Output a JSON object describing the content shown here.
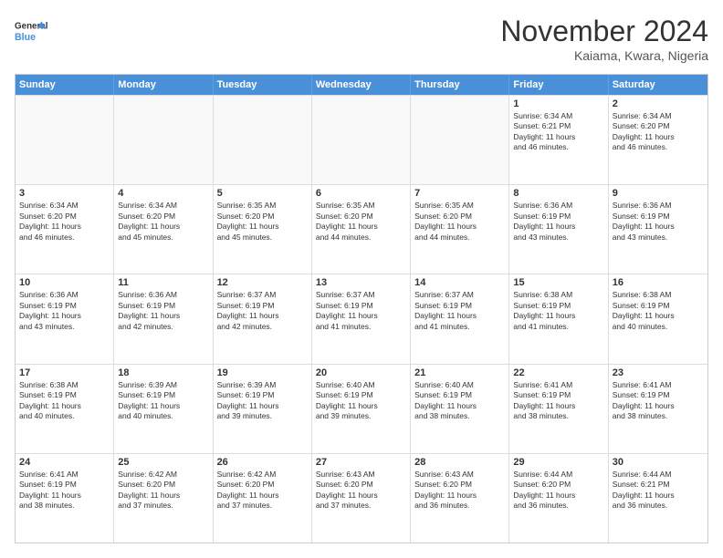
{
  "logo": {
    "line1": "General",
    "line2": "Blue"
  },
  "title": "November 2024",
  "location": "Kaiama, Kwara, Nigeria",
  "header_days": [
    "Sunday",
    "Monday",
    "Tuesday",
    "Wednesday",
    "Thursday",
    "Friday",
    "Saturday"
  ],
  "weeks": [
    [
      {
        "day": "",
        "info": ""
      },
      {
        "day": "",
        "info": ""
      },
      {
        "day": "",
        "info": ""
      },
      {
        "day": "",
        "info": ""
      },
      {
        "day": "",
        "info": ""
      },
      {
        "day": "1",
        "info": "Sunrise: 6:34 AM\nSunset: 6:21 PM\nDaylight: 11 hours\nand 46 minutes."
      },
      {
        "day": "2",
        "info": "Sunrise: 6:34 AM\nSunset: 6:20 PM\nDaylight: 11 hours\nand 46 minutes."
      }
    ],
    [
      {
        "day": "3",
        "info": "Sunrise: 6:34 AM\nSunset: 6:20 PM\nDaylight: 11 hours\nand 46 minutes."
      },
      {
        "day": "4",
        "info": "Sunrise: 6:34 AM\nSunset: 6:20 PM\nDaylight: 11 hours\nand 45 minutes."
      },
      {
        "day": "5",
        "info": "Sunrise: 6:35 AM\nSunset: 6:20 PM\nDaylight: 11 hours\nand 45 minutes."
      },
      {
        "day": "6",
        "info": "Sunrise: 6:35 AM\nSunset: 6:20 PM\nDaylight: 11 hours\nand 44 minutes."
      },
      {
        "day": "7",
        "info": "Sunrise: 6:35 AM\nSunset: 6:20 PM\nDaylight: 11 hours\nand 44 minutes."
      },
      {
        "day": "8",
        "info": "Sunrise: 6:36 AM\nSunset: 6:19 PM\nDaylight: 11 hours\nand 43 minutes."
      },
      {
        "day": "9",
        "info": "Sunrise: 6:36 AM\nSunset: 6:19 PM\nDaylight: 11 hours\nand 43 minutes."
      }
    ],
    [
      {
        "day": "10",
        "info": "Sunrise: 6:36 AM\nSunset: 6:19 PM\nDaylight: 11 hours\nand 43 minutes."
      },
      {
        "day": "11",
        "info": "Sunrise: 6:36 AM\nSunset: 6:19 PM\nDaylight: 11 hours\nand 42 minutes."
      },
      {
        "day": "12",
        "info": "Sunrise: 6:37 AM\nSunset: 6:19 PM\nDaylight: 11 hours\nand 42 minutes."
      },
      {
        "day": "13",
        "info": "Sunrise: 6:37 AM\nSunset: 6:19 PM\nDaylight: 11 hours\nand 41 minutes."
      },
      {
        "day": "14",
        "info": "Sunrise: 6:37 AM\nSunset: 6:19 PM\nDaylight: 11 hours\nand 41 minutes."
      },
      {
        "day": "15",
        "info": "Sunrise: 6:38 AM\nSunset: 6:19 PM\nDaylight: 11 hours\nand 41 minutes."
      },
      {
        "day": "16",
        "info": "Sunrise: 6:38 AM\nSunset: 6:19 PM\nDaylight: 11 hours\nand 40 minutes."
      }
    ],
    [
      {
        "day": "17",
        "info": "Sunrise: 6:38 AM\nSunset: 6:19 PM\nDaylight: 11 hours\nand 40 minutes."
      },
      {
        "day": "18",
        "info": "Sunrise: 6:39 AM\nSunset: 6:19 PM\nDaylight: 11 hours\nand 40 minutes."
      },
      {
        "day": "19",
        "info": "Sunrise: 6:39 AM\nSunset: 6:19 PM\nDaylight: 11 hours\nand 39 minutes."
      },
      {
        "day": "20",
        "info": "Sunrise: 6:40 AM\nSunset: 6:19 PM\nDaylight: 11 hours\nand 39 minutes."
      },
      {
        "day": "21",
        "info": "Sunrise: 6:40 AM\nSunset: 6:19 PM\nDaylight: 11 hours\nand 38 minutes."
      },
      {
        "day": "22",
        "info": "Sunrise: 6:41 AM\nSunset: 6:19 PM\nDaylight: 11 hours\nand 38 minutes."
      },
      {
        "day": "23",
        "info": "Sunrise: 6:41 AM\nSunset: 6:19 PM\nDaylight: 11 hours\nand 38 minutes."
      }
    ],
    [
      {
        "day": "24",
        "info": "Sunrise: 6:41 AM\nSunset: 6:19 PM\nDaylight: 11 hours\nand 38 minutes."
      },
      {
        "day": "25",
        "info": "Sunrise: 6:42 AM\nSunset: 6:20 PM\nDaylight: 11 hours\nand 37 minutes."
      },
      {
        "day": "26",
        "info": "Sunrise: 6:42 AM\nSunset: 6:20 PM\nDaylight: 11 hours\nand 37 minutes."
      },
      {
        "day": "27",
        "info": "Sunrise: 6:43 AM\nSunset: 6:20 PM\nDaylight: 11 hours\nand 37 minutes."
      },
      {
        "day": "28",
        "info": "Sunrise: 6:43 AM\nSunset: 6:20 PM\nDaylight: 11 hours\nand 36 minutes."
      },
      {
        "day": "29",
        "info": "Sunrise: 6:44 AM\nSunset: 6:20 PM\nDaylight: 11 hours\nand 36 minutes."
      },
      {
        "day": "30",
        "info": "Sunrise: 6:44 AM\nSunset: 6:21 PM\nDaylight: 11 hours\nand 36 minutes."
      }
    ]
  ]
}
